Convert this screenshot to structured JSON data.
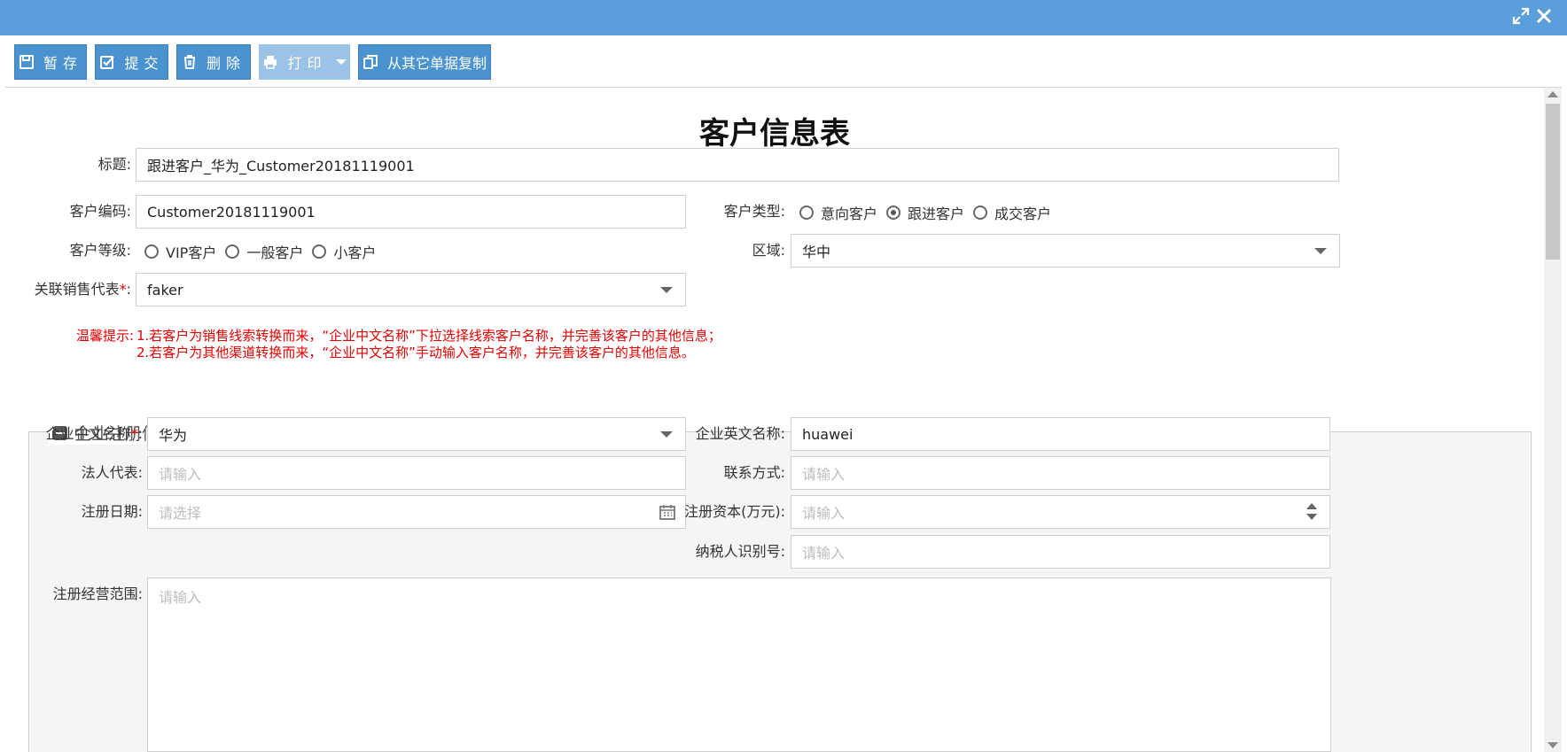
{
  "window": {
    "icons": [
      "expand-icon",
      "close-icon"
    ]
  },
  "toolbar": {
    "save": "暂存",
    "submit": "提交",
    "delete": "删除",
    "print": "打印",
    "copy": "从其它单据复制"
  },
  "form": {
    "title": "客户信息表",
    "title_field": {
      "label": "标题:",
      "value": "跟进客户_华为_Customer20181119001"
    },
    "customer_code": {
      "label": "客户编码:",
      "value": "Customer20181119001"
    },
    "customer_type": {
      "label": "客户类型:",
      "options": [
        "意向客户",
        "跟进客户",
        "成交客户"
      ],
      "selected": "跟进客户"
    },
    "customer_level": {
      "label": "客户等级:",
      "options": [
        "VIP客户",
        "一般客户",
        "小客户"
      ]
    },
    "region": {
      "label": "区域:",
      "value": "华中"
    },
    "sales_rep": {
      "label": "关联销售代表",
      "required": "*",
      "colon": ":",
      "value": "faker"
    },
    "tips": {
      "label": "温馨提示:",
      "line1": "1.若客户为销售线索转换而来，“企业中文名称”下拉选择线索客户名称，并完善该客户的其他信息；",
      "line2": "2.若客户为其他渠道转换而来，“企业中文名称”手动输入客户名称，并完善该客户的其他信息。"
    }
  },
  "section": {
    "title": "企业注册信息",
    "cn_name": {
      "label": "企业中文名称",
      "required": "*",
      "colon": ":",
      "value": "华为"
    },
    "en_name": {
      "label": "企业英文名称:",
      "value": "huawei"
    },
    "legal_rep": {
      "label": "法人代表:",
      "placeholder": "请输入"
    },
    "contact": {
      "label": "联系方式:",
      "placeholder": "请输入"
    },
    "reg_date": {
      "label": "注册日期:",
      "placeholder": "请选择"
    },
    "reg_capital": {
      "label": "注册资本(万元):",
      "placeholder": "请输入"
    },
    "taxpayer_id": {
      "label": "纳税人识别号:",
      "placeholder": "请输入"
    },
    "business_scope": {
      "label": "注册经营范围:",
      "placeholder": "请输入"
    }
  },
  "colors": {
    "accent": "#4a93cf",
    "titlebar": "#5a9fdb",
    "required": "#e60000"
  }
}
